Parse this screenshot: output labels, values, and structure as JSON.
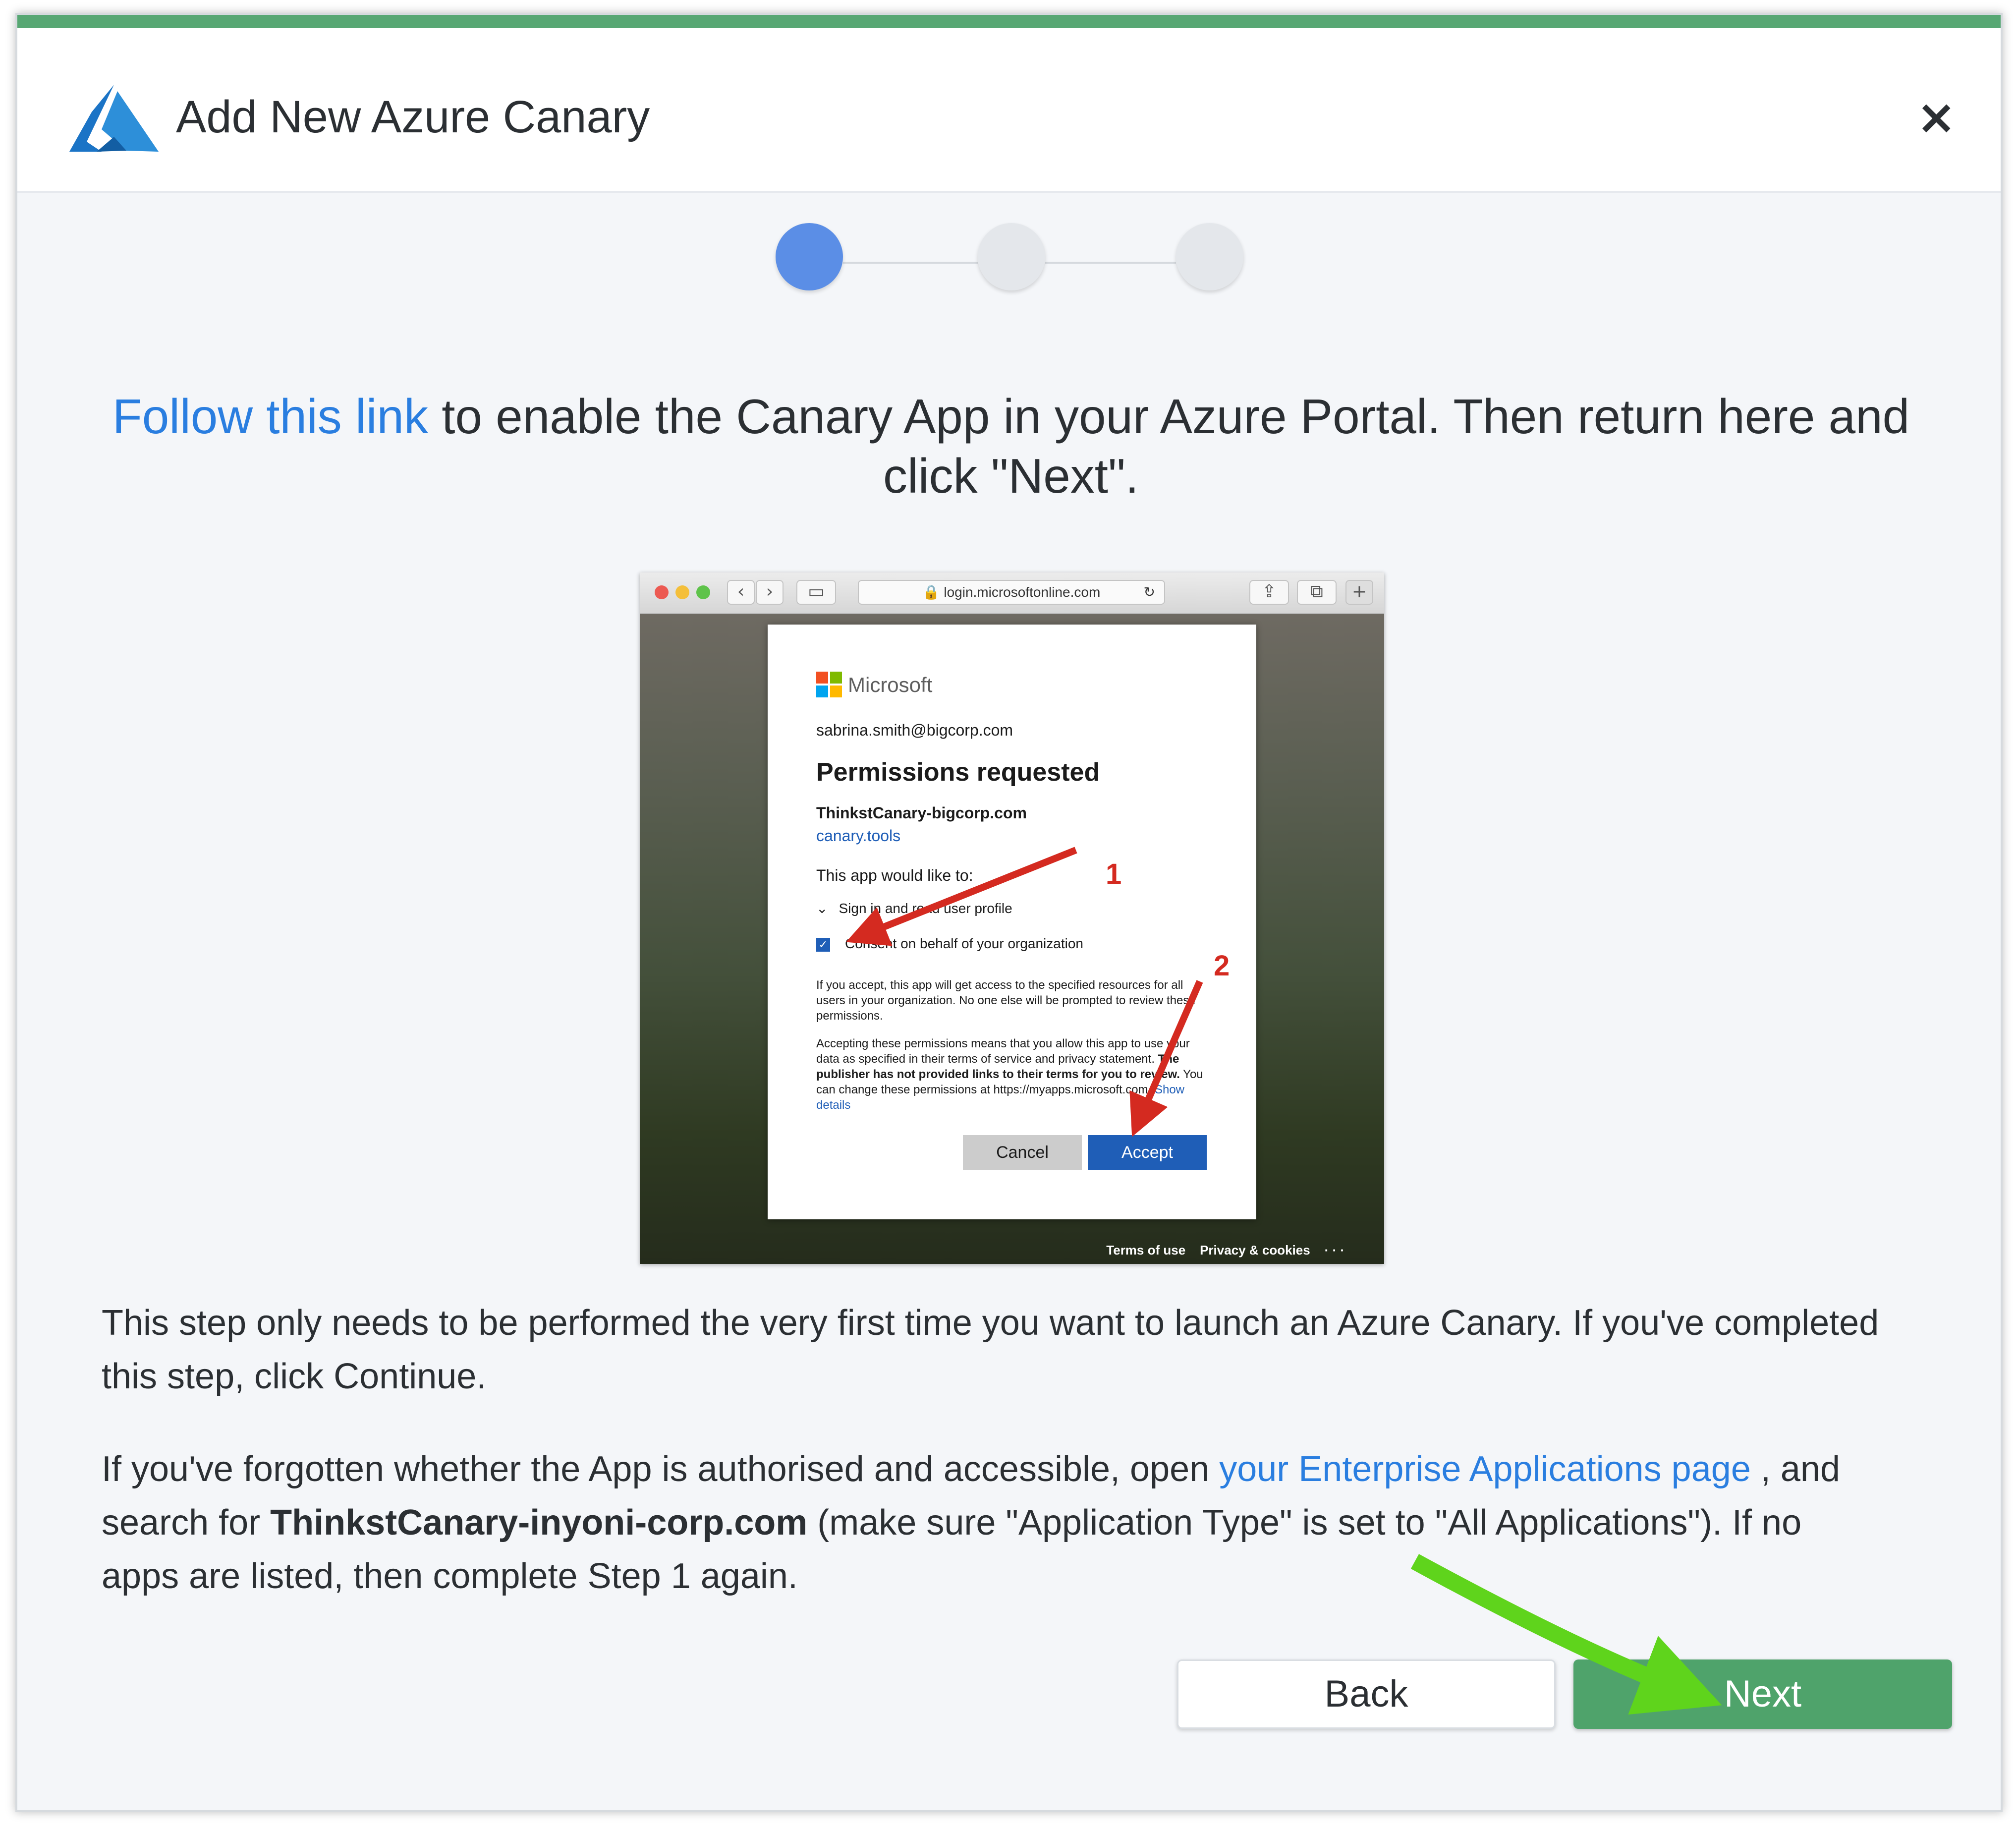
{
  "header": {
    "title": "Add New Azure Canary",
    "close_icon": "×"
  },
  "stepper": {
    "steps": [
      {
        "state": "active"
      },
      {
        "state": "inactive"
      },
      {
        "state": "inactive"
      }
    ]
  },
  "instruction": {
    "link_text": "Follow this link",
    "text": " to enable the Canary App in your Azure Portal. Then return here and click \"Next\"."
  },
  "screenshot": {
    "url": "login.microsoftonline.com",
    "brand": "Microsoft",
    "email": "sabrina.smith@bigcorp.com",
    "heading": "Permissions requested",
    "app_name": "ThinkstCanary-bigcorp.com",
    "app_link": "canary.tools",
    "would_like": "This app would like to:",
    "permission_1": "Sign in and read user profile",
    "consent_label": "Consent on behalf of your organization",
    "notice_1": "If you accept, this app will get access to the specified resources for all users in your organization. No one else will be prompted to review these permissions.",
    "notice_2_a": "Accepting these permissions means that you allow this app to use your data as specified in their terms of service and privacy statement. ",
    "notice_2_b": "The publisher has not provided links to their terms for you to review.",
    "notice_2_c": " You can change these permissions at https://myapps.microsoft.com. ",
    "show_details": "Show details",
    "cancel_label": "Cancel",
    "accept_label": "Accept",
    "footer_terms": "Terms of use",
    "footer_privacy": "Privacy & cookies",
    "footer_more": "· · ·",
    "annotation_1": "1",
    "annotation_2": "2"
  },
  "body": {
    "para1": "This step only needs to be performed the very first time you want to launch an Azure Canary. If you've completed this step, click Continue.",
    "para2_a": "If you've forgotten whether the App is authorised and accessible, open ",
    "para2_link": "your Enterprise Applications page",
    "para2_b": " , and search for ",
    "para2_bold": "ThinkstCanary-inyoni-corp.com",
    "para2_c": " (make sure \"Application Type\" is set to \"All Applications\"). If no apps are listed, then complete Step 1 again."
  },
  "buttons": {
    "back_label": "Back",
    "next_label": "Next"
  },
  "colors": {
    "accent_green": "#4fa36b",
    "link_blue": "#2a7ee0",
    "step_active": "#5b8ee6",
    "annotation_red": "#d42a20",
    "arrow_green": "#5fd41c"
  }
}
